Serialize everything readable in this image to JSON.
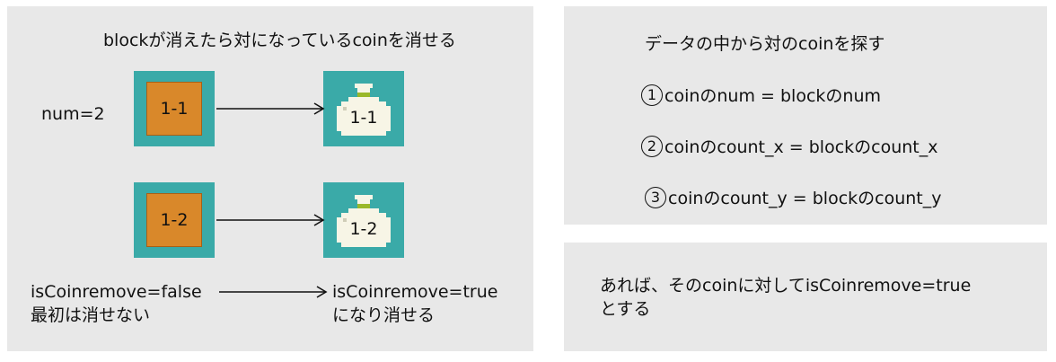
{
  "left_panel": {
    "title": "blockが消えたら対になっているcoinを消せる",
    "num_label": "num=2",
    "pairs": [
      {
        "block_label": "1-1",
        "coin_label": "1-1"
      },
      {
        "block_label": "1-2",
        "coin_label": "1-2"
      }
    ],
    "before_state": {
      "line1": "isCoinremove=false",
      "line2": "最初は消せない"
    },
    "after_state": {
      "line1": "isCoinremove=true",
      "line2": "になり消せる"
    }
  },
  "right_top_panel": {
    "title": "データの中から対のcoinを探す",
    "conditions": [
      {
        "marker": "1",
        "text": "coinのnum = blockのnum"
      },
      {
        "marker": "2",
        "text": "coinのcount_x = blockのcount_x"
      },
      {
        "marker": "3",
        "text": "coinのcount_y = blockのcount_y"
      }
    ]
  },
  "right_bottom_panel": {
    "line1": "あれば、そのcoinに対してisCoinremove=true",
    "line2": "とする"
  },
  "colors": {
    "panel_bg": "#e8e8e8",
    "tile_teal": "#3aaaa8",
    "block_orange": "#d9882a",
    "coin_body": "#f7f5e6",
    "coin_band": "#9ab82a"
  }
}
